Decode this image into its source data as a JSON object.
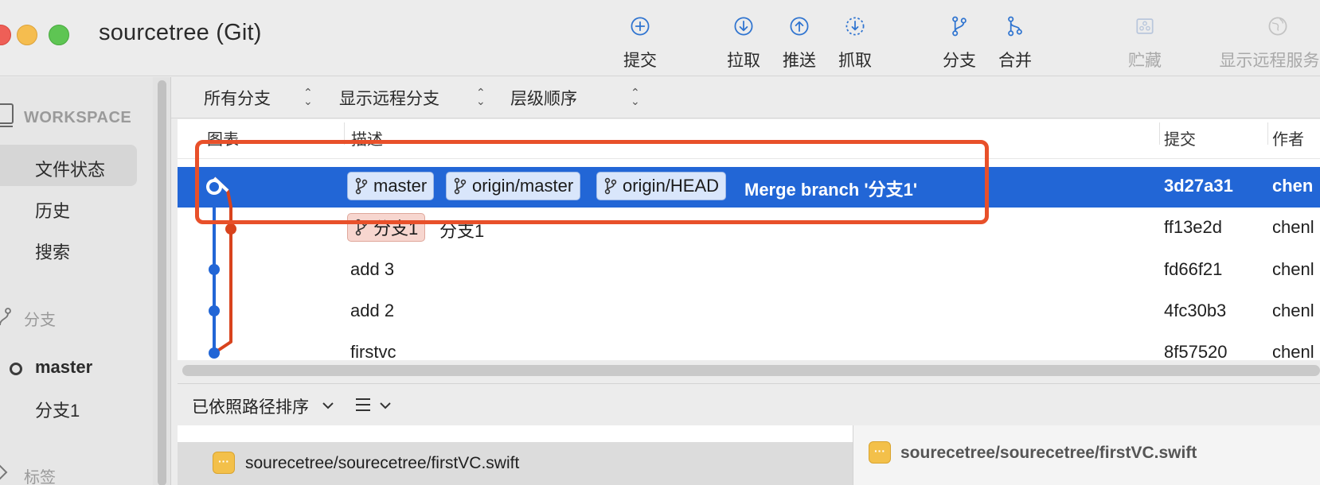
{
  "window": {
    "title": "sourcetree (Git)"
  },
  "toolbar": [
    {
      "label": "提交",
      "icon": "plus-circle-icon"
    },
    {
      "label": "拉取",
      "icon": "arrow-down-circle-icon"
    },
    {
      "label": "推送",
      "icon": "arrow-up-circle-icon"
    },
    {
      "label": "抓取",
      "icon": "fetch-dashed-circle-icon"
    },
    {
      "label": "分支",
      "icon": "branch-icon"
    },
    {
      "label": "合并",
      "icon": "merge-icon"
    },
    {
      "label": "贮藏",
      "icon": "stash-icon",
      "disabled": true
    },
    {
      "label": "显示远程服务器",
      "icon": "globe-icon",
      "disabled": true
    }
  ],
  "sidebar": {
    "workspace_label": "WORKSPACE",
    "items": [
      {
        "label": "文件状态",
        "selected": true
      },
      {
        "label": "历史"
      },
      {
        "label": "搜索"
      }
    ],
    "branches_label": "分支",
    "branches": [
      {
        "label": "master",
        "current": true
      },
      {
        "label": "分支1"
      }
    ],
    "tags_label": "标签"
  },
  "filters": {
    "branches": "所有分支",
    "remote": "显示远程分支",
    "order": "层级顺序"
  },
  "columns": {
    "graph": "图表",
    "description": "描述",
    "commit": "提交",
    "author": "作者"
  },
  "commits": [
    {
      "tags": [
        "master",
        "origin/master",
        "origin/HEAD"
      ],
      "message": "Merge branch '分支1'",
      "hash": "3d27a31",
      "author": "chen",
      "selected": true
    },
    {
      "tags": [
        "分支1"
      ],
      "message": "分支1",
      "hash": "ff13e2d",
      "author": "chenl"
    },
    {
      "tags": [],
      "message": "add 3",
      "hash": "fd66f21",
      "author": "chenl"
    },
    {
      "tags": [],
      "message": "add 2",
      "hash": "4fc30b3",
      "author": "chenl"
    },
    {
      "tags": [],
      "message": "firstvc",
      "hash": "8f57520",
      "author": "chenl"
    }
  ],
  "bottom": {
    "sort_label": "已依照路径排序",
    "files": [
      {
        "path": "sourecetree/sourecetree/firstVC.swift",
        "status_glyph": "···"
      }
    ],
    "diff_header": "sourecetree/sourecetree/firstVC.swift"
  },
  "colors": {
    "selection": "#2266d6",
    "branch_master": "#2266d6",
    "branch_other": "#d8431d",
    "annotation": "#e8502a"
  }
}
